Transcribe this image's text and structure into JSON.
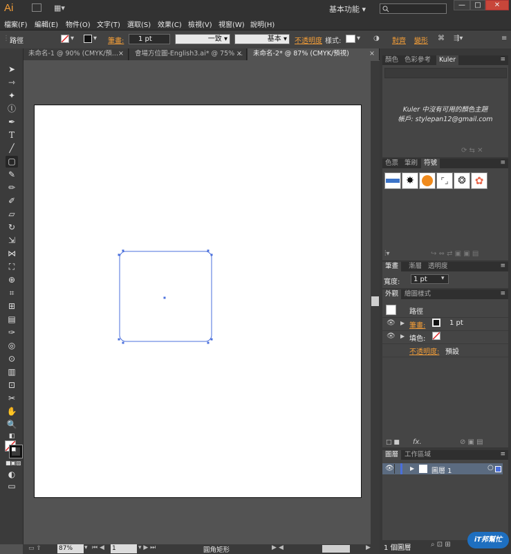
{
  "app": {
    "logo": "Ai",
    "workspace": "基本功能",
    "workspace_arrow": "▾",
    "window_controls": {
      "minimize": "—",
      "maximize": "□",
      "close": "✕"
    }
  },
  "menu": [
    "檔案(F)",
    "編輯(E)",
    "物件(O)",
    "文字(T)",
    "選取(S)",
    "效果(C)",
    "檢視(V)",
    "視窗(W)",
    "說明(H)"
  ],
  "control_bar": {
    "selection_label": "路徑",
    "stroke_label": "筆畫:",
    "stroke_weight": "1 pt",
    "profile_label": "一致",
    "brush_label": "基本",
    "opacity_label": "不透明度",
    "style_label": "樣式:",
    "align_label": "對齊",
    "transform_label": "變形"
  },
  "doc_tabs": [
    {
      "label": "未命名-1 @ 90% (CMYK/預...",
      "close": "×"
    },
    {
      "label": "會場方位圖-English3.ai* @ 75% ...",
      "close": "×"
    },
    {
      "label": "未命名-2* @ 87% (CMYK/預視)",
      "close": "×"
    }
  ],
  "right_panels": {
    "color_tabs": [
      "顏色",
      "色彩參考",
      "Kuler"
    ],
    "kuler_message": "Kuler 中沒有可用的顏色主題",
    "kuler_account": "帳戶: stylepan12@gmail.com",
    "symbol_tabs": [
      "色票",
      "筆刷",
      "符號"
    ],
    "stroke_tabs": [
      "筆畫",
      "漸層",
      "透明度"
    ],
    "stroke_width_label": "寬度:",
    "stroke_width_value": "1 pt",
    "appearance_tabs": [
      "外觀",
      "繪圖樣式"
    ],
    "appearance": {
      "object_label": "路徑",
      "stroke_label": "筆畫:",
      "stroke_value": "1 pt",
      "fill_label": "填色:",
      "opacity_label": "不透明度:",
      "opacity_value": "預設",
      "fx_label": "fx."
    },
    "layers_tabs": [
      "圖層",
      "工作區域"
    ],
    "layer_name": "圖層 1",
    "layer_count": "1 個圖層"
  },
  "status_bar": {
    "zoom": "87%",
    "page": "1",
    "tool_name": "圓角矩形"
  },
  "watermark": "iT邦幫忙",
  "colors": {
    "accent_orange": "#f29d38",
    "selection_blue": "#4a6fdc",
    "layer_color": "#4a6fdc"
  }
}
